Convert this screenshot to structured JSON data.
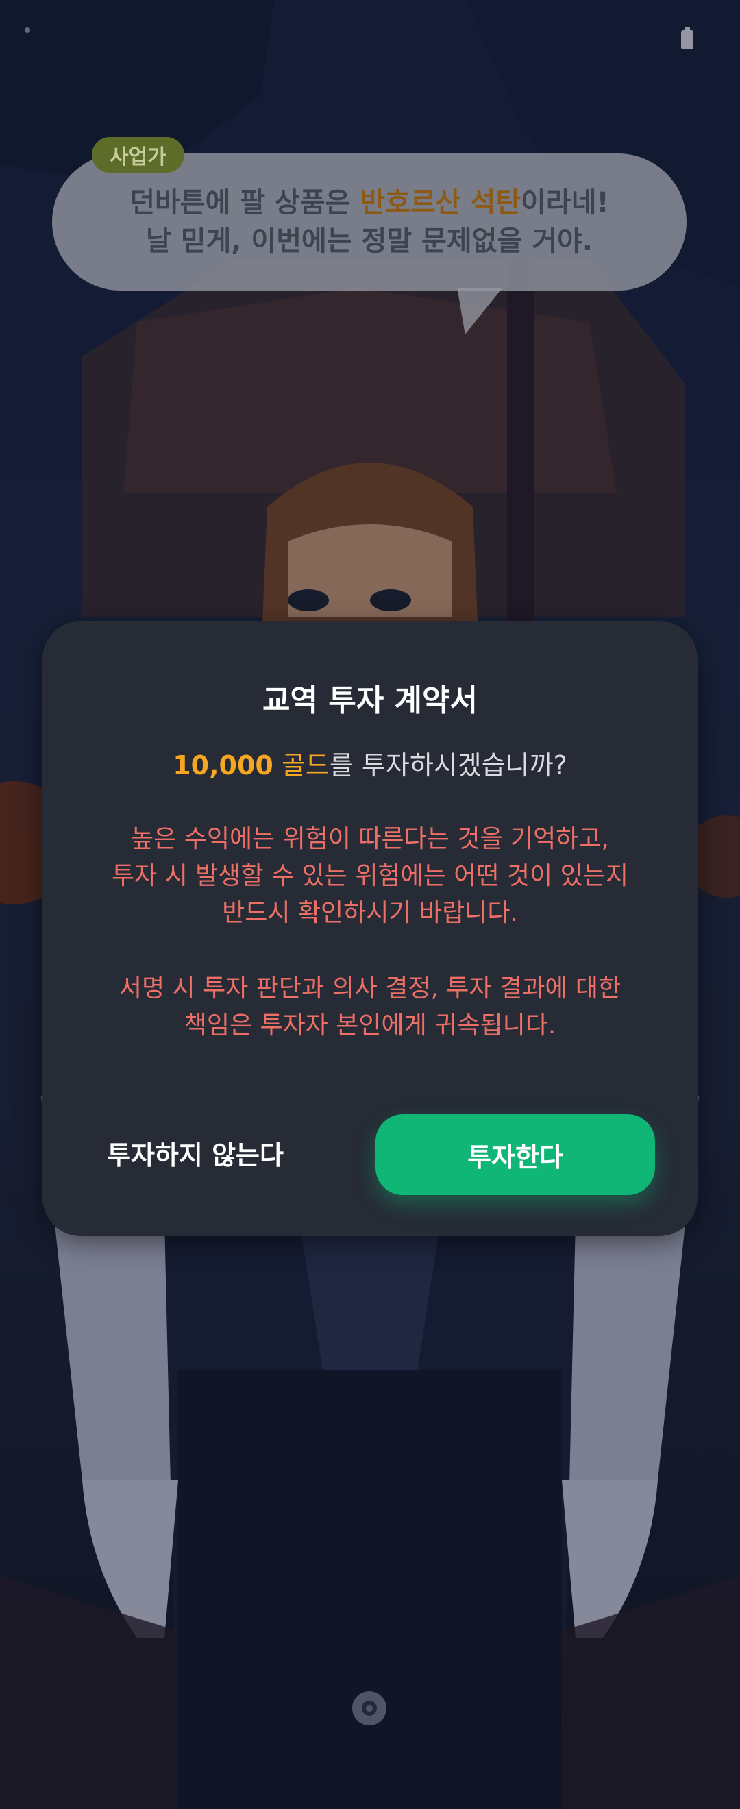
{
  "dialogue": {
    "speaker": "사업가",
    "line1_pre": "던바튼에 팔 상품은 ",
    "line1_highlight": "반호르산 석탄",
    "line1_post": "이라네!",
    "line2": "날 믿게, 이번에는 정말 문제없을 거야."
  },
  "modal": {
    "title": "교역 투자 계약서",
    "question_amount": "10,000",
    "question_unit": " 골드",
    "question_rest": "를 투자하시겠습니까?",
    "warning1": [
      "높은 수익에는 위험이 따른다는 것을 기억하고,",
      "투자 시 발생할 수 있는 위험에는 어떤 것이 있는지",
      "반드시 확인하시기 바랍니다."
    ],
    "warning2": [
      "서명 시 투자 판단과 의사 결정, 투자 결과에 대한",
      "책임은 투자자 본인에게 귀속됩니다."
    ],
    "decline_label": "투자하지 않는다",
    "accept_label": "투자한다"
  },
  "colors": {
    "accent_green": "#10b675",
    "gold": "#f5a623",
    "warning_red": "#ee6f66",
    "modal_bg": "#262b36"
  },
  "icons": {
    "battery": "battery-icon",
    "logo": "app-logo-icon"
  }
}
